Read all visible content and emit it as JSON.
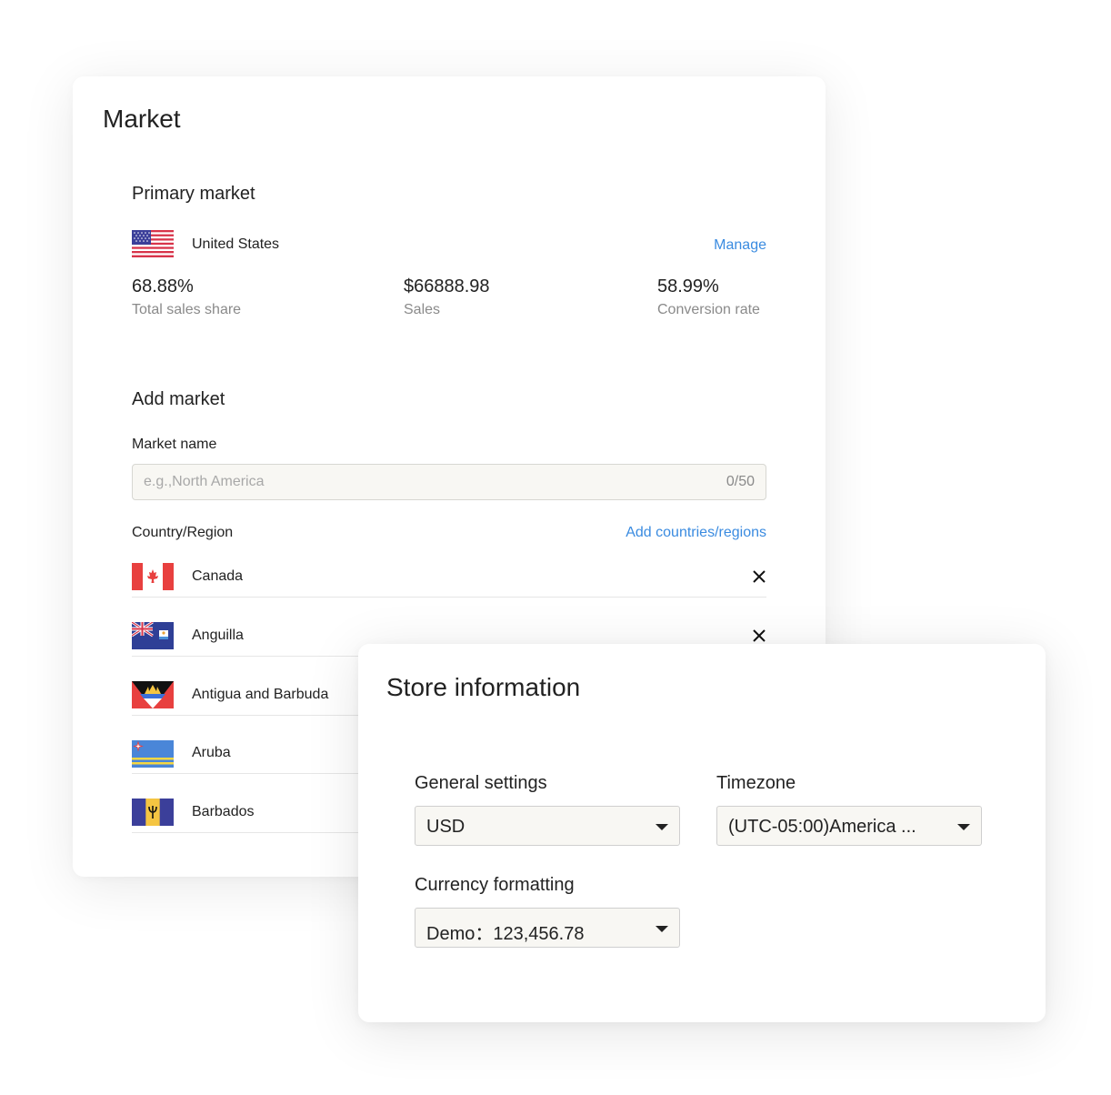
{
  "market": {
    "title": "Market",
    "primary_heading": "Primary market",
    "primary_country": "United States",
    "manage_label": "Manage",
    "stats": [
      {
        "value": "68.88%",
        "label": "Total sales share"
      },
      {
        "value": "$66888.98",
        "label": "Sales"
      },
      {
        "value": "58.99%",
        "label": "Conversion rate"
      }
    ],
    "add_heading": "Add market",
    "market_name_label": "Market name",
    "market_name_placeholder": "e.g.,North America",
    "market_name_counter": "0/50",
    "country_label": "Country/Region",
    "add_countries_label": "Add countries/regions",
    "countries": [
      "Canada",
      "Anguilla",
      "Antigua and Barbuda",
      "Aruba",
      "Barbados"
    ],
    "link_color": "#3a8be0"
  },
  "store": {
    "title": "Store information",
    "general_label": "General settings",
    "general_value": "USD",
    "timezone_label": "Timezone",
    "timezone_value": "(UTC-05:00)America ...",
    "currency_label": "Currency formatting",
    "currency_value": "Demo：123,456.78"
  }
}
